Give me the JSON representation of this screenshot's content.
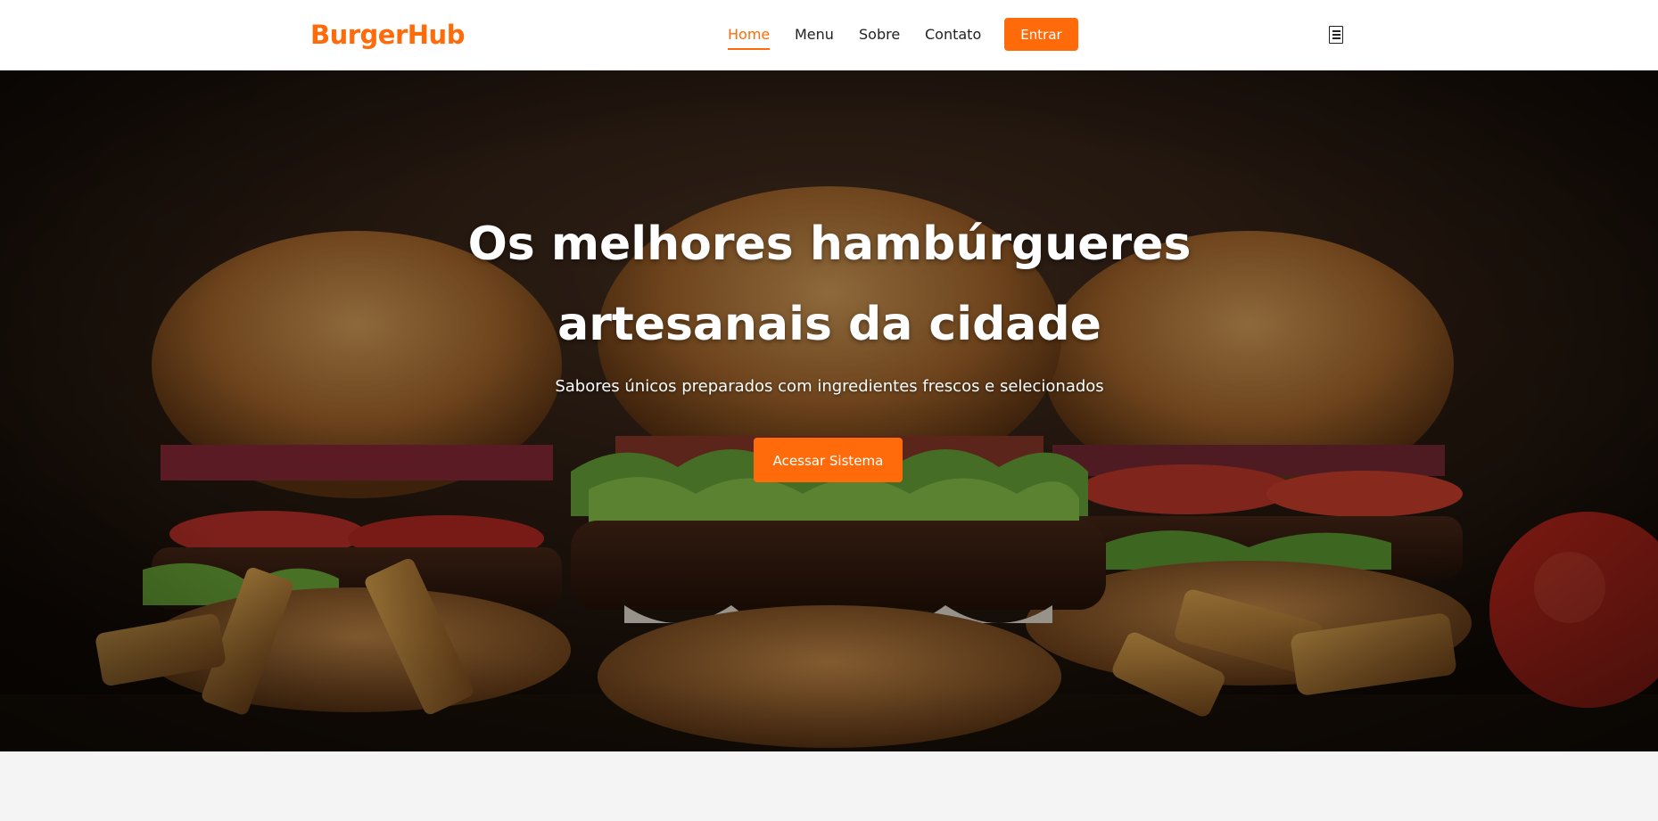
{
  "brand": {
    "name": "BurgerHub",
    "accent_color": "#ff6b0a"
  },
  "nav": {
    "items": [
      {
        "label": "Home",
        "active": true
      },
      {
        "label": "Menu",
        "active": false
      },
      {
        "label": "Sobre",
        "active": false
      },
      {
        "label": "Contato",
        "active": false
      }
    ],
    "login_label": "Entrar",
    "menu_icon": "hamburger-menu-icon"
  },
  "hero": {
    "title_line1": "Os melhores hambúrgueres",
    "title_line2": "artesanais da cidade",
    "subtitle": "Sabores únicos preparados com ingredientes frescos e selecionados",
    "cta_label": "Acessar Sistema",
    "background_image": "burgers-and-fries-photo"
  }
}
